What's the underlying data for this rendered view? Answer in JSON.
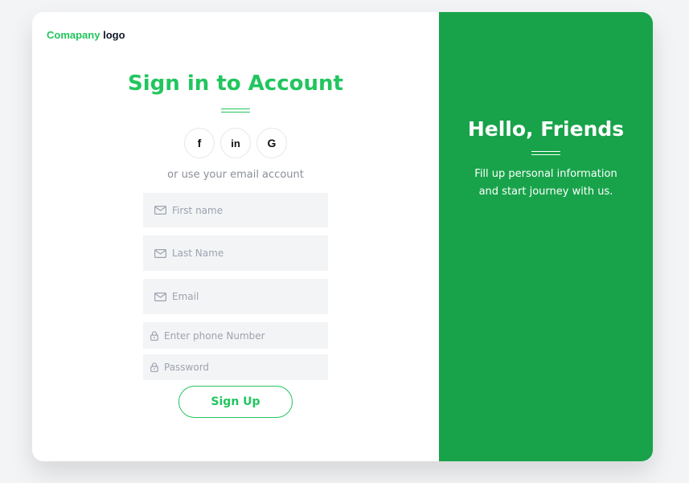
{
  "logo": {
    "brand": "Comapany",
    "word": "logo"
  },
  "form": {
    "title": "Sign in to Account",
    "social": {
      "facebook": "f",
      "linkedin": "in",
      "google": "G"
    },
    "alt_text": "or use your email account",
    "fields": {
      "first_name": {
        "placeholder": "First name"
      },
      "last_name": {
        "placeholder": "Last Name"
      },
      "email": {
        "placeholder": "Email"
      },
      "phone": {
        "placeholder": "Enter phone Number"
      },
      "password": {
        "placeholder": "Password"
      }
    },
    "submit_label": "Sign Up"
  },
  "panel": {
    "heading": "Hello, Friends",
    "line1": "Fill up personal information",
    "line2": "and start journey with us."
  },
  "icons": {
    "field_icon_mail": "mail-icon",
    "field_icon_lock": "lock-icon"
  },
  "colors": {
    "accent": "#22c55e",
    "panel": "#18a34a",
    "field_bg": "#f3f4f6",
    "page_bg": "#f3f4f6"
  }
}
